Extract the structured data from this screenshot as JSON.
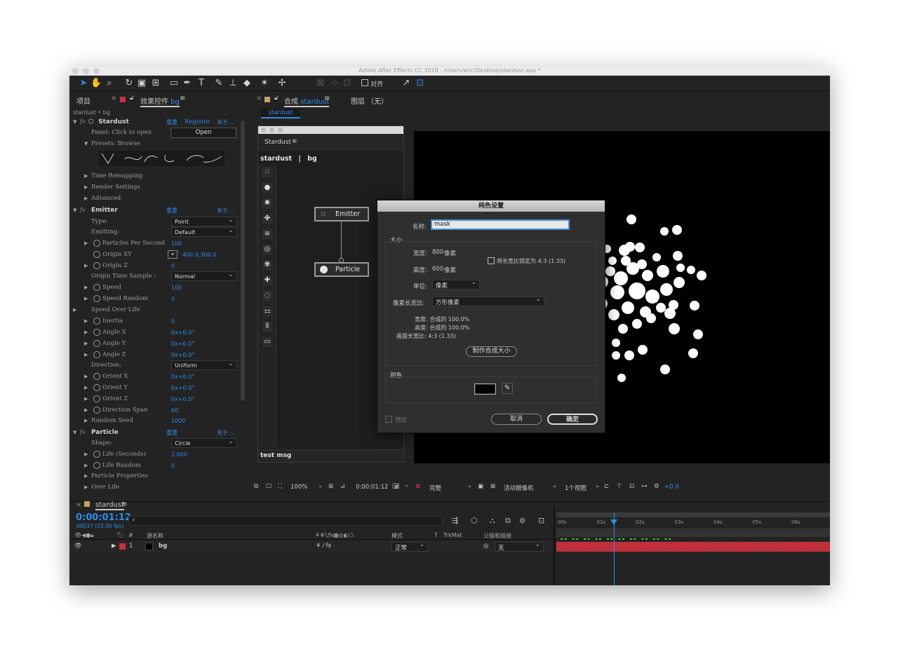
{
  "window": {
    "title": "Adobe After Effects CC 2018 - /Users/eric/Desktop/stardust.aep *"
  },
  "toolbar": {
    "align_label": "对齐"
  },
  "left_panel": {
    "tab_project": "项目",
    "tab_effects_prefix": "效果控件",
    "tab_effects_layer": "bg",
    "breadcrumb": "stardust • bg",
    "effects": [
      {
        "name": "Stardust",
        "reset": "重置",
        "register": "Register",
        "about": "关于..."
      },
      {
        "name": "Emitter",
        "reset": "重置",
        "about": "关于..."
      },
      {
        "name": "Particle",
        "reset": "重置",
        "about": "关于..."
      }
    ],
    "panel_click": "Panel: Click to open",
    "open_button": "Open",
    "presets_label": "Presets: Browse",
    "time_remapping": "Time Remapping",
    "render_settings": "Render Settings",
    "advanced": "Advanced",
    "emitter_props": {
      "type_label": "Type:",
      "type_value": "Point",
      "emitting_label": "Emitting:",
      "emitting_value": "Default",
      "pps_label": "Particles Per Second",
      "pps_value": "100",
      "origin_xy_label": "Origin XY",
      "origin_xy_value": "400.0,300.0",
      "origin_z_label": "Origin Z",
      "origin_z_value": "0",
      "ots_label": "Origin Time Sample :",
      "ots_value": "Normal",
      "speed_label": "Speed",
      "speed_value": "100",
      "speed_random_label": "Speed Random",
      "speed_random_value": "0",
      "speed_over_life_label": "Speed Over Life",
      "inertia_label": "Inertia",
      "inertia_value": "0",
      "angle_x_label": "Angle X",
      "angle_x_value": "0x+0.0°",
      "angle_y_label": "Angle Y",
      "angle_y_value": "0x+0.0°",
      "angle_z_label": "Angle Z",
      "angle_z_value": "0x+0.0°",
      "direction_label": "Direction:",
      "direction_value": "Uniform",
      "orient_x_label": "Orient X",
      "orient_x_value": "0x+0.0°",
      "orient_y_label": "Orient Y",
      "orient_y_value": "0x+0.0°",
      "orient_z_label": "Orient Z",
      "orient_z_value": "0x+0.0°",
      "direction_span_label": "Direction Span",
      "direction_span_value": "60",
      "random_seed_label": "Random Seed",
      "random_seed_value": "1000"
    },
    "particle_props": {
      "shape_label": "Shape:",
      "shape_value": "Circle",
      "life_label": "Life (Seconds)",
      "life_value": "2.000",
      "life_random_label": "Life Random",
      "life_random_value": "0",
      "particle_properties_label": "Particle Properties",
      "over_life_label": "Over Life"
    }
  },
  "comp_panel": {
    "tab_prefix": "合成",
    "tab_name": "stardust",
    "layer_tab": "图层 （无）",
    "sub_tab": "stardust",
    "zoom": "100%",
    "timecode": "0:00:01:12",
    "quality": "完整",
    "camera": "活动摄像机",
    "views": "1个视图",
    "offset": "+0.0"
  },
  "stardust_panel": {
    "title": "Stardust",
    "path_comp": "stardust",
    "path_sep": "|",
    "path_layer": "bg",
    "node_emitter": "Emitter",
    "node_particle": "Particle",
    "status": "test msg"
  },
  "dialog": {
    "title": "纯色设置",
    "name_label": "名称:",
    "name_value": "mask",
    "size_heading": "大小",
    "width_label": "宽度:",
    "width_value": "800",
    "width_unit": "像素",
    "height_label": "高度:",
    "height_value": "600",
    "height_unit": "像素",
    "lock_label": "将长宽比锁定为 4:3 (1.33)",
    "units_label": "单位:",
    "units_value": "像素",
    "par_label": "像素长宽比:",
    "par_value": "方形像素",
    "info_width": "宽度: 合成的 100.0%",
    "info_height": "高度: 合成的 100.0%",
    "info_frame": "画面长宽比: 4:3 (1.33)",
    "make_comp_size": "制作合成大小",
    "color_heading": "颜色",
    "color_value": "#000000",
    "preview_label": "预览",
    "cancel": "取消",
    "ok": "确定"
  },
  "timeline": {
    "comp_tab": "stardust",
    "timecode": "0:00:01:12",
    "frames": "00037 (25.00 fps)",
    "col_hash": "#",
    "col_source": "源名称",
    "col_mode": "模式",
    "col_t": "T",
    "col_trkmat": "TrkMat",
    "col_parent": "父级和链接",
    "layer_num": "1",
    "layer_name": "bg",
    "layer_mode": "正常",
    "layer_parent": "无",
    "ruler": [
      "00s",
      "01s",
      "02s",
      "03s",
      "04s",
      "05s",
      "06s"
    ],
    "playhead_seconds": 1.48,
    "layer_color": "#c8303a"
  },
  "colors": {
    "accent": "#2d8ceb",
    "panel": "#232323",
    "dialog": "#2f2f2f"
  }
}
